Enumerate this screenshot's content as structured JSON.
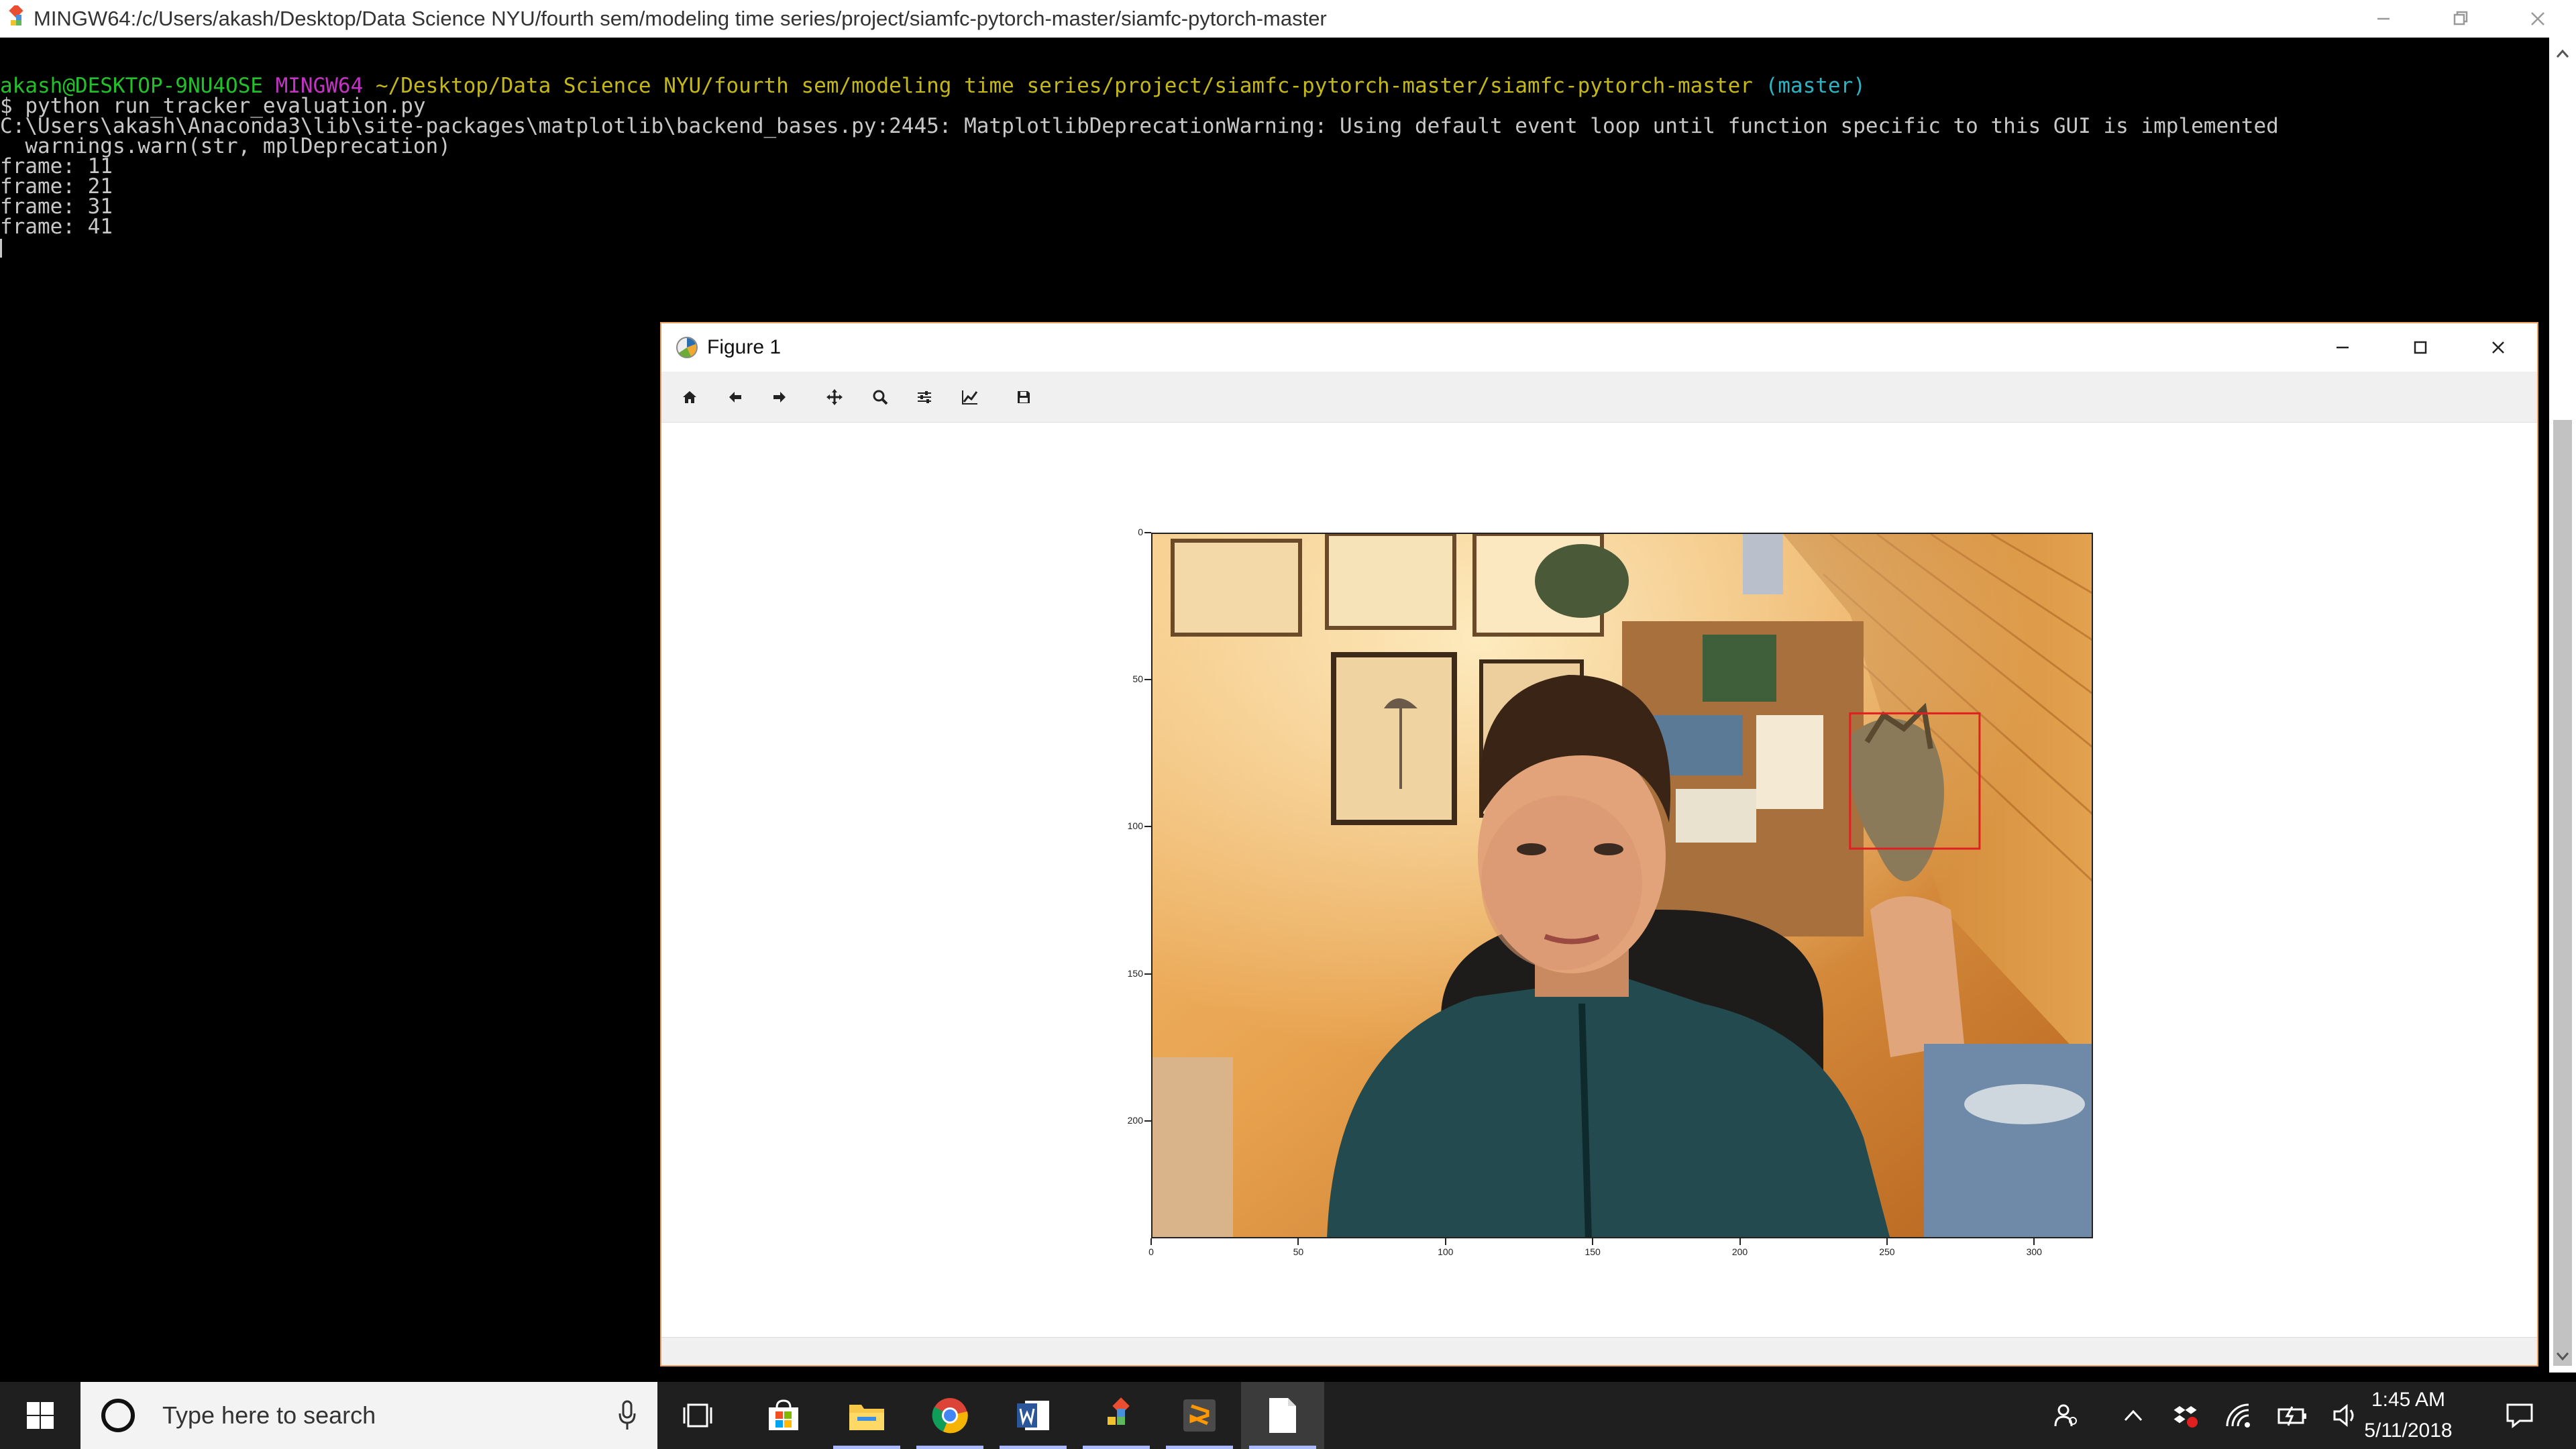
{
  "terminal": {
    "title": "MINGW64:/c/Users/akash/Desktop/Data Science NYU/fourth sem/modeling time series/project/siamfc-pytorch-master/siamfc-pytorch-master",
    "prompt": {
      "user_host": "akash@DESKTOP-9NU4OSE",
      "shell": "MINGW64",
      "path": "~/Desktop/Data Science NYU/fourth sem/modeling time series/project/siamfc-pytorch-master/siamfc-pytorch-master",
      "branch": "(master)"
    },
    "lines": [
      "$ python run_tracker_evaluation.py",
      "C:\\Users\\akash\\Anaconda3\\lib\\site-packages\\matplotlib\\backend_bases.py:2445: MatplotlibDeprecationWarning: Using default event loop until function specific to this GUI is implemented",
      "  warnings.warn(str, mplDeprecation)",
      "frame: 11",
      "frame: 21",
      "frame: 31",
      "frame: 41"
    ],
    "colors": {
      "user": "#22c12b",
      "shell": "#c433c4",
      "path": "#c4b817",
      "branch": "#2bb3c4",
      "text": "#c8c8c8"
    }
  },
  "figure": {
    "title": "Figure 1",
    "toolbar": [
      {
        "name": "home-icon",
        "label": "Home"
      },
      {
        "name": "back-arrow-icon",
        "label": "Back"
      },
      {
        "name": "forward-arrow-icon",
        "label": "Forward"
      },
      {
        "name": "pan-icon",
        "label": "Pan"
      },
      {
        "name": "zoom-icon",
        "label": "Zoom"
      },
      {
        "name": "subplots-icon",
        "label": "Configure subplots"
      },
      {
        "name": "edit-axis-icon",
        "label": "Edit axis"
      },
      {
        "name": "save-icon",
        "label": "Save"
      }
    ],
    "axes": {
      "x_ticks": [
        "0",
        "50",
        "100",
        "150",
        "200",
        "250",
        "300"
      ],
      "y_ticks": [
        "0",
        "50",
        "100",
        "150",
        "200"
      ],
      "xlim": [
        0,
        320
      ],
      "ylim": [
        240,
        0
      ],
      "image": "webcam frame: person holding a toy figure in a wood-paneled room",
      "tracking_box": {
        "x": [
          237,
          281
        ],
        "y": [
          61,
          107
        ],
        "color": "#e02020"
      }
    }
  },
  "taskbar": {
    "search_placeholder": "Type here to search",
    "apps": [
      "task-view-icon",
      "store-icon",
      "file-explorer-icon",
      "chrome-icon",
      "word-icon",
      "git-icon",
      "sublime-icon",
      "file-icon"
    ],
    "clock": {
      "time": "1:45 AM",
      "date": "5/11/2018"
    }
  }
}
